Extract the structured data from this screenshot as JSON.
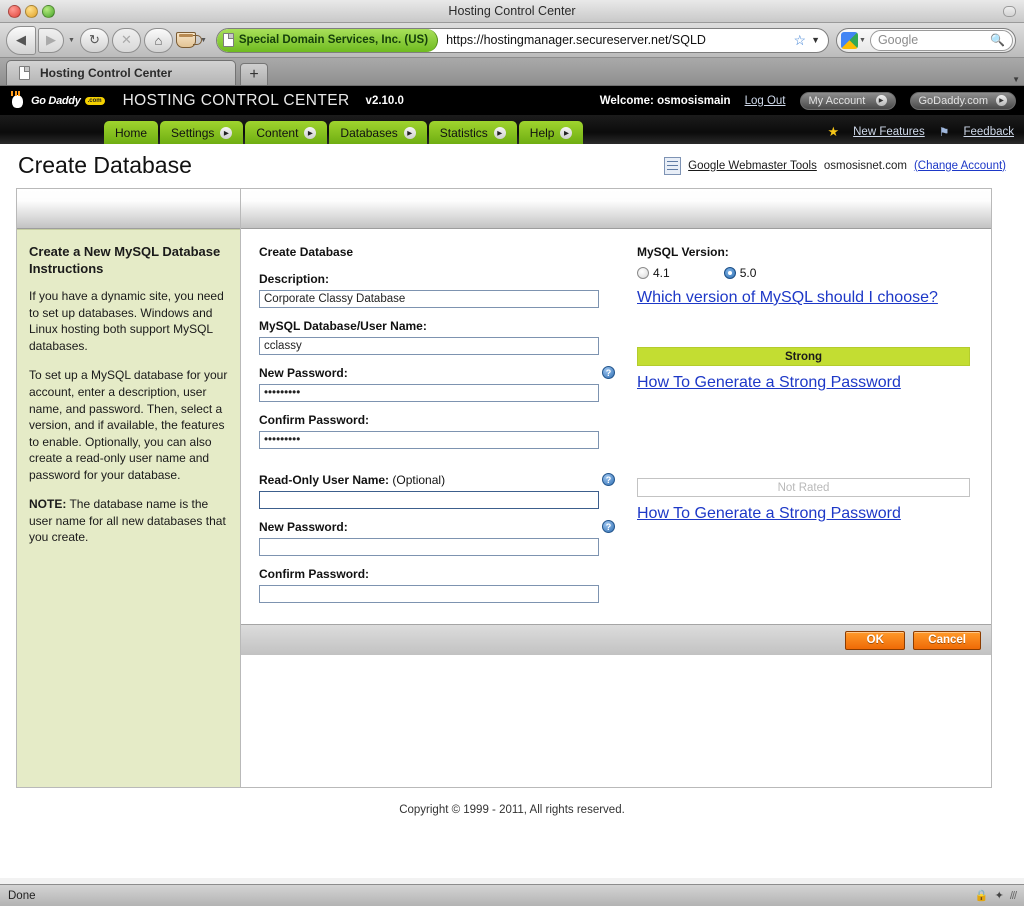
{
  "browser": {
    "window_title": "Hosting Control Center",
    "nav": {
      "back_icon": "back-arrow-icon",
      "forward_icon": "forward-arrow-icon",
      "reload_icon": "reload-icon",
      "stop_icon": "stop-icon",
      "home_icon": "home-icon",
      "coffee_icon": "coffee-cup-icon"
    },
    "address": {
      "ev_certificate": "Special Domain Services, Inc. (US)",
      "url": "https://hostingmanager.secureserver.net/SQLD",
      "bookmark_icon": "star-icon",
      "dropdown_icon": "chevron-down-icon"
    },
    "search": {
      "engine_icon": "google-icon",
      "placeholder": "Google",
      "search_icon": "magnifier-icon"
    },
    "tab": {
      "label": "Hosting Control Center",
      "new_tab_label": "+"
    },
    "status": {
      "text": "Done",
      "lock_icon": "lock-icon",
      "resize_grip": "resize-grip-icon"
    }
  },
  "app_header": {
    "logo_text": "Go Daddy",
    "logo_badge": ".com",
    "product_title": "HOSTING CONTROL CENTER",
    "version": "v2.10.0",
    "welcome": "Welcome: osmosismain",
    "log_out": "Log Out",
    "buttons": [
      {
        "label": "My Account"
      },
      {
        "label": "GoDaddy.com"
      }
    ]
  },
  "nav_menu": {
    "items": [
      {
        "label": "Home",
        "has_arrow": false
      },
      {
        "label": "Settings",
        "has_arrow": true
      },
      {
        "label": "Content",
        "has_arrow": true
      },
      {
        "label": "Databases",
        "has_arrow": true
      },
      {
        "label": "Statistics",
        "has_arrow": true
      },
      {
        "label": "Help",
        "has_arrow": true
      }
    ],
    "right_links": [
      {
        "label": "New Features",
        "icon": "star-icon"
      },
      {
        "label": "Feedback",
        "icon": "flag-icon"
      }
    ]
  },
  "page": {
    "title": "Create Database",
    "webmaster_tools_link": "Google Webmaster Tools",
    "account_domain": "osmosisnet.com",
    "change_account_link": "(Change Account)"
  },
  "instructions": {
    "title": "Create a New MySQL Database Instructions",
    "paragraphs": [
      "If you have a dynamic site, you need to set up databases. Windows and Linux hosting both support MySQL databases.",
      "To set up a MySQL database for your account, enter a description, user name, and password. Then, select a version, and if available, the features to enable. Optionally, you can also create a read-only user name and password for your database."
    ],
    "note_label": "NOTE:",
    "note_text": " The database name is the user name for all new databases that you create."
  },
  "form": {
    "section_title": "Create Database",
    "description": {
      "label": "Description:",
      "value": "Corporate Classy Database",
      "placeholder": ""
    },
    "db_user_name": {
      "label": "MySQL Database/User Name:",
      "value": "cclassy",
      "placeholder": ""
    },
    "new_password": {
      "label": "New Password:",
      "value": "•••••••••",
      "placeholder": "",
      "help_icon": "help-icon"
    },
    "confirm_password": {
      "label": "Confirm Password:",
      "value": "•••••••••",
      "placeholder": ""
    },
    "readonly_user": {
      "label": "Read-Only User Name:",
      "optional": " (Optional)",
      "value": "",
      "placeholder": "",
      "help_icon": "help-icon"
    },
    "readonly_new_password": {
      "label": "New Password:",
      "value": "",
      "placeholder": "",
      "help_icon": "help-icon"
    },
    "readonly_confirm_password": {
      "label": "Confirm Password:",
      "value": "",
      "placeholder": ""
    }
  },
  "options": {
    "mysql_version_label": "MySQL Version:",
    "versions": [
      {
        "label": "4.1",
        "selected": false
      },
      {
        "label": "5.0",
        "selected": true
      }
    ],
    "version_help_link": "Which version of MySQL should I choose?",
    "primary_strength": {
      "text": "Strong",
      "color": "#c3dd32"
    },
    "primary_strength_link": "How To Generate a Strong Password",
    "secondary_strength": {
      "text": "Not Rated",
      "color": "#ffffff"
    },
    "secondary_strength_link": "How To Generate a Strong Password"
  },
  "actions": {
    "ok_label": "OK",
    "cancel_label": "Cancel",
    "button_color": "#ef6a06"
  },
  "footer": {
    "copyright": "Copyright © 1999 - 2011, All rights reserved."
  }
}
